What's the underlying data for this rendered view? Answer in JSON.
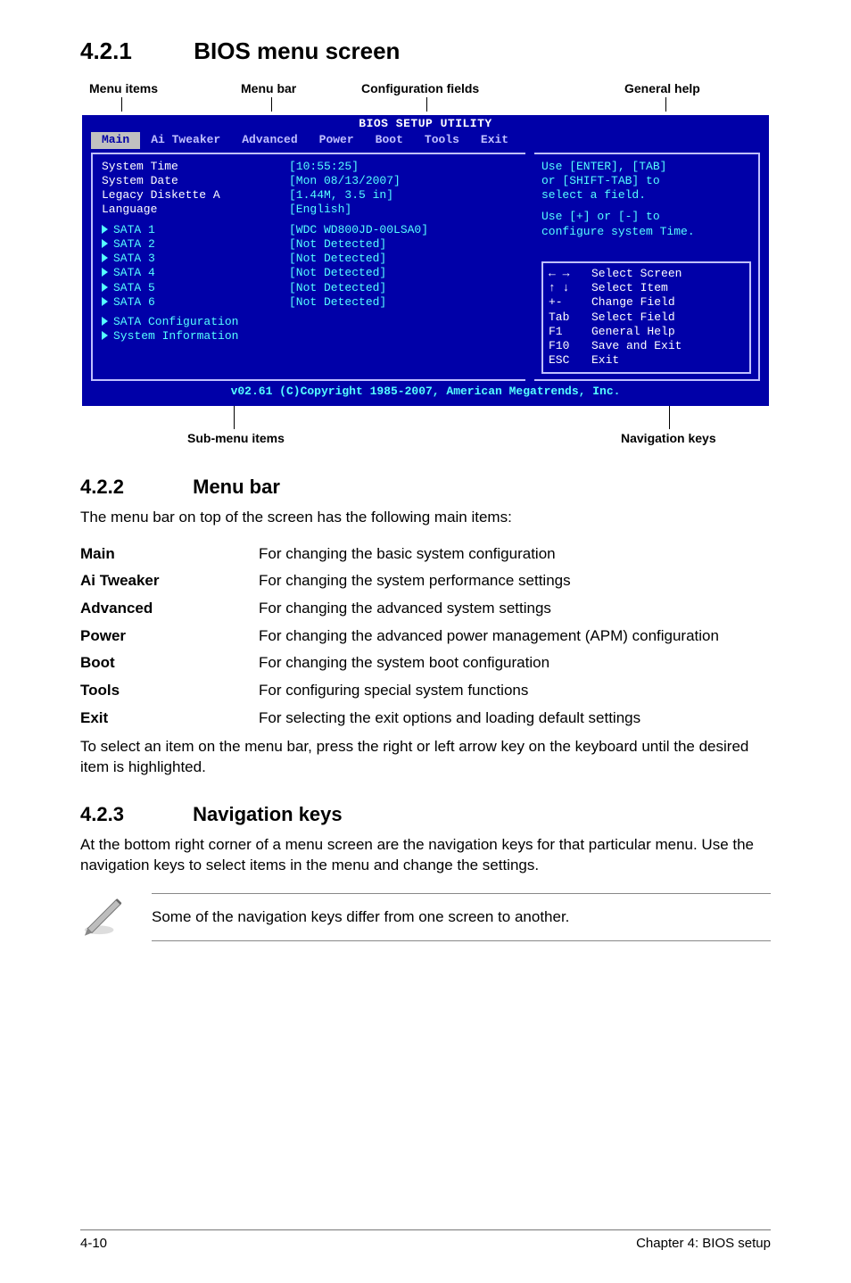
{
  "sections": {
    "s421": {
      "num": "4.2.1",
      "title": "BIOS menu screen"
    },
    "s422": {
      "num": "4.2.2",
      "title": "Menu bar"
    },
    "s423": {
      "num": "4.2.3",
      "title": "Navigation keys"
    }
  },
  "callouts": {
    "menu_items": "Menu items",
    "menu_bar": "Menu bar",
    "config_fields": "Configuration fields",
    "general_help": "General help",
    "sub_menu": "Sub-menu items",
    "nav_keys": "Navigation keys"
  },
  "bios": {
    "title": "BIOS SETUP UTILITY",
    "tabs": [
      "Main",
      "Ai Tweaker",
      "Advanced",
      "Power",
      "Boot",
      "Tools",
      "Exit"
    ],
    "rows": {
      "system_time": {
        "label": "System Time",
        "value": "[10:55:25]"
      },
      "system_date": {
        "label": "System Date",
        "value": "[Mon 08/13/2007]"
      },
      "legacy": {
        "label": "Legacy Diskette A",
        "value": "[1.44M, 3.5 in]"
      },
      "language": {
        "label": "Language",
        "value": "[English]"
      },
      "sata1": {
        "label": "SATA 1",
        "value": "[WDC WD800JD-00LSA0]"
      },
      "sata2": {
        "label": "SATA 2",
        "value": "[Not Detected]"
      },
      "sata3": {
        "label": "SATA 3",
        "value": "[Not Detected]"
      },
      "sata4": {
        "label": "SATA 4",
        "value": "[Not Detected]"
      },
      "sata5": {
        "label": "SATA 5",
        "value": "[Not Detected]"
      },
      "sata6": {
        "label": "SATA 6",
        "value": "[Not Detected]"
      },
      "sata_cfg": {
        "label": "SATA Configuration"
      },
      "sys_info": {
        "label": "System Information"
      }
    },
    "help_top": {
      "l1": "Use [ENTER], [TAB]",
      "l2": "or [SHIFT-TAB] to",
      "l3": "select a field.",
      "l4": "Use [+] or [-] to",
      "l5": "configure system Time."
    },
    "help_keys": {
      "select_screen": "Select Screen",
      "select_item": "Select Item",
      "change_field": "Change Field",
      "select_field": "Select Field",
      "general_help": "General Help",
      "save_exit": "Save and Exit",
      "exit": "Exit",
      "k_pm": "+-",
      "k_tab": "Tab",
      "k_f1": "F1",
      "k_f10": "F10",
      "k_esc": "ESC"
    },
    "footer": "v02.61 (C)Copyright 1985-2007, American Megatrends, Inc."
  },
  "menubar_intro": "The menu bar on top of the screen has the following main items:",
  "defs": {
    "main": {
      "term": "Main",
      "desc": "For changing the basic system configuration"
    },
    "ai_tweaker": {
      "term": "Ai Tweaker",
      "desc": "For changing the system performance settings"
    },
    "advanced": {
      "term": "Advanced",
      "desc": "For changing the advanced system settings"
    },
    "power": {
      "term": "Power",
      "desc": "For changing the advanced power management (APM) configuration"
    },
    "boot": {
      "term": "Boot",
      "desc": "For changing the system boot configuration"
    },
    "tools": {
      "term": "Tools",
      "desc": "For configuring special system functions"
    },
    "exit": {
      "term": "Exit",
      "desc": "For selecting the exit options and loading default settings"
    }
  },
  "menubar_outro": "To select an item on the menu bar, press the right or left arrow key on the keyboard until the desired item is highlighted.",
  "navkeys_body": "At the bottom right corner of a menu screen are the navigation keys for that particular menu. Use the navigation keys to select items in the menu and change the settings.",
  "note": "Some of the navigation keys differ from one screen to another.",
  "footer": {
    "left": "4-10",
    "right": "Chapter 4: BIOS setup"
  }
}
